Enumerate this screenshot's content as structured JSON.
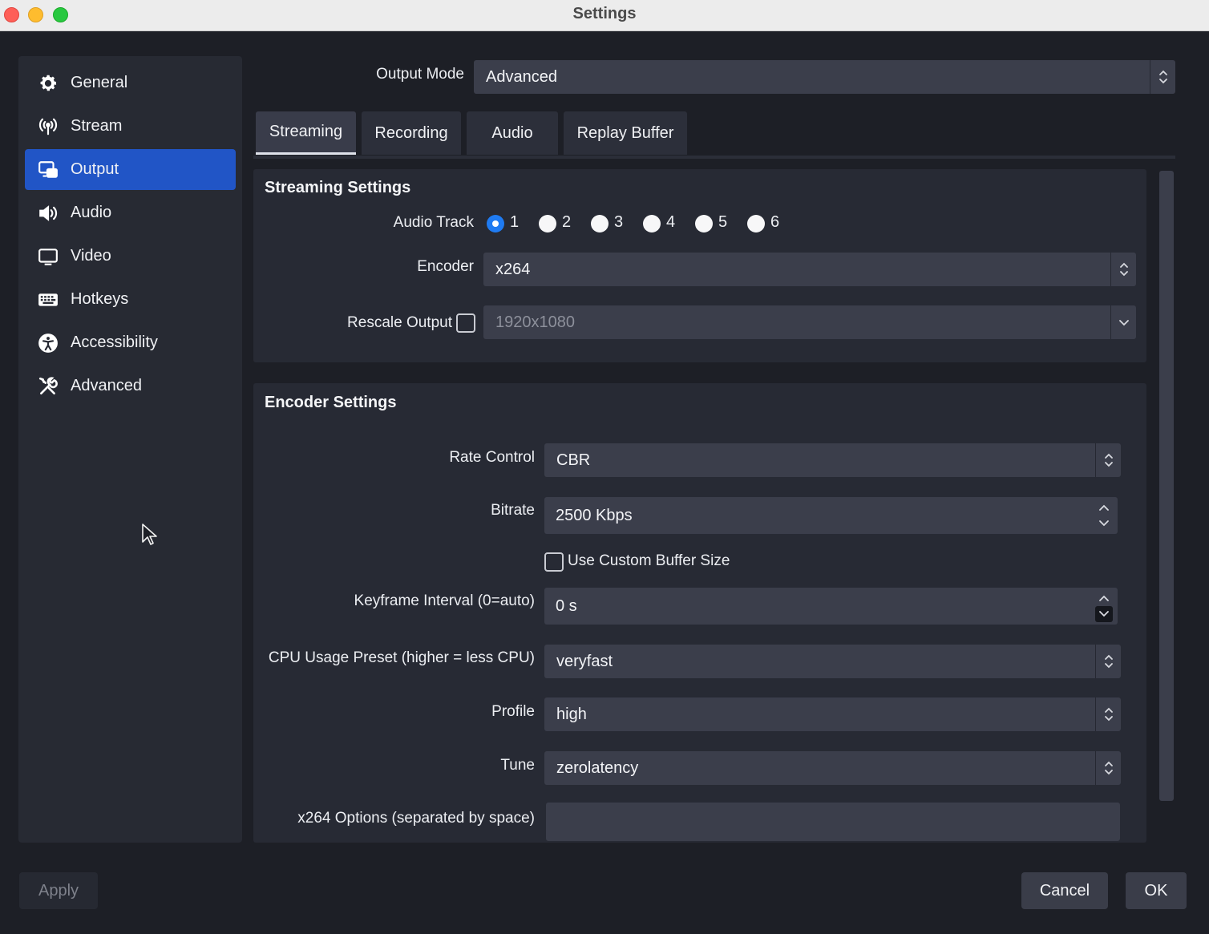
{
  "window": {
    "title": "Settings"
  },
  "sidebar": {
    "items": [
      {
        "label": "General",
        "icon": "gear-icon"
      },
      {
        "label": "Stream",
        "icon": "broadcast-icon"
      },
      {
        "label": "Output",
        "icon": "output-icon",
        "active": true
      },
      {
        "label": "Audio",
        "icon": "speaker-icon"
      },
      {
        "label": "Video",
        "icon": "monitor-icon"
      },
      {
        "label": "Hotkeys",
        "icon": "keyboard-icon"
      },
      {
        "label": "Accessibility",
        "icon": "accessibility-icon"
      },
      {
        "label": "Advanced",
        "icon": "tools-icon"
      }
    ]
  },
  "output_mode": {
    "label": "Output Mode",
    "value": "Advanced"
  },
  "tabs": [
    {
      "label": "Streaming",
      "active": true
    },
    {
      "label": "Recording"
    },
    {
      "label": "Audio"
    },
    {
      "label": "Replay Buffer"
    }
  ],
  "streaming_settings": {
    "title": "Streaming Settings",
    "audio_track_label": "Audio Track",
    "audio_tracks": [
      "1",
      "2",
      "3",
      "4",
      "5",
      "6"
    ],
    "audio_track_selected": "1",
    "encoder_label": "Encoder",
    "encoder_value": "x264",
    "rescale_label": "Rescale Output",
    "rescale_checked": false,
    "rescale_value": "1920x1080"
  },
  "encoder_settings": {
    "title": "Encoder Settings",
    "rate_control_label": "Rate Control",
    "rate_control_value": "CBR",
    "bitrate_label": "Bitrate",
    "bitrate_value": "2500 Kbps",
    "custom_buffer_label": "Use Custom Buffer Size",
    "custom_buffer_checked": false,
    "keyframe_label": "Keyframe Interval (0=auto)",
    "keyframe_value": "0 s",
    "cpu_preset_label": "CPU Usage Preset (higher = less CPU)",
    "cpu_preset_value": "veryfast",
    "profile_label": "Profile",
    "profile_value": "high",
    "tune_label": "Tune",
    "tune_value": "zerolatency",
    "x264_options_label": "x264 Options (separated by space)",
    "x264_options_value": ""
  },
  "buttons": {
    "apply": "Apply",
    "cancel": "Cancel",
    "ok": "OK"
  },
  "colors": {
    "accent": "#2155c6",
    "radio_checked": "#1f7bf2",
    "background": "#1d1f26",
    "panel": "#272a34"
  }
}
